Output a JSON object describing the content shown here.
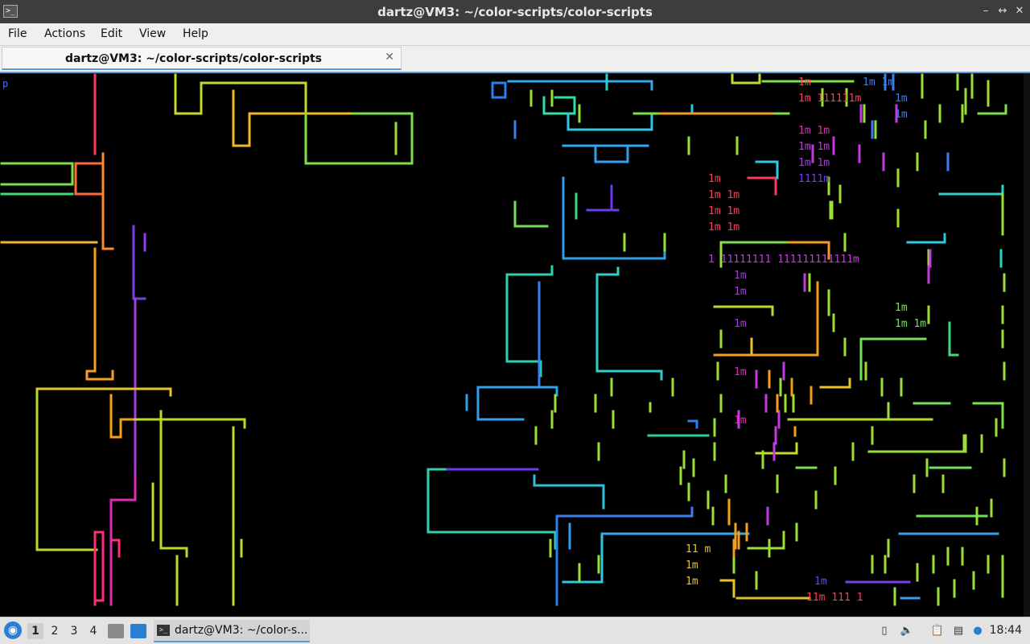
{
  "window": {
    "title": "dartz@VM3: ~/color-scripts/color-scripts",
    "app_icon": "terminal-icon",
    "buttons": [
      "minimize",
      "maximize",
      "close"
    ]
  },
  "menu": {
    "file": "File",
    "actions": "Actions",
    "edit": "Edit",
    "view": "View",
    "help": "Help"
  },
  "tab": {
    "label": "dartz@VM3: ~/color-scripts/color-scripts",
    "close_icon": "close-icon"
  },
  "terminal": {
    "prompt_char": "p",
    "background": "#000000",
    "text_fragments": {
      "r1": "1m",
      "r2": "1m  1m",
      "r3": "1m  111111m",
      "r4": "1m",
      "r5": "1m",
      "r6": "1m  1m",
      "r7": "1m  1m",
      "r8": "1m  1m",
      "r9": "1111m",
      "r10": "1m",
      "r11": "1m  1m",
      "r12": "1m  1m",
      "r13": "1m  1m",
      "r14": "1 11111111  111111111111m",
      "r15": "1m",
      "r16": "1m",
      "r17": "1m",
      "r18": "1m",
      "r19": "1m",
      "r20": "1m",
      "r21": "1m 1m",
      "r22": "11  m",
      "r23": "1m",
      "r24": "1m",
      "r25": "1m",
      "r26": "11m  111  1"
    }
  },
  "taskbar": {
    "workspaces": [
      "1",
      "2",
      "3",
      "4"
    ],
    "active_workspace": "1",
    "task_label": "dartz@VM3: ~/color-s...",
    "clock": "18:44"
  },
  "colors": {
    "accent": "#5b9bd5",
    "titlebar": "#3d3d3d",
    "menubar": "#efefef"
  }
}
